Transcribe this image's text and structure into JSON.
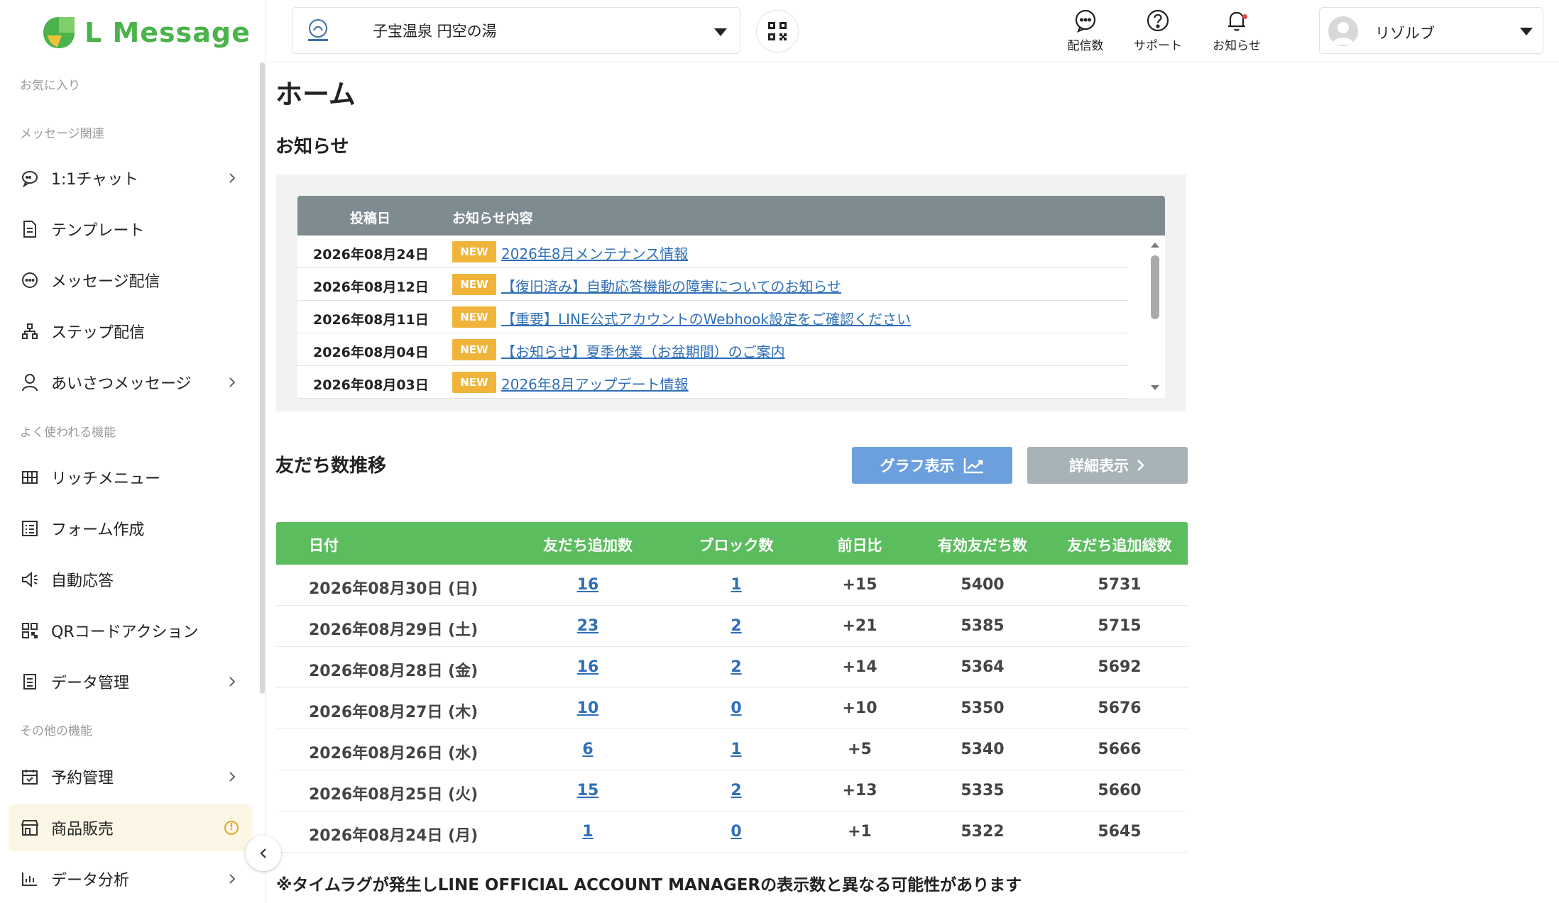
{
  "brand": {
    "logo_text": "L Message",
    "accent": "#4bb34b"
  },
  "sidebar": {
    "sections": {
      "favorites": "お気に入り",
      "message": "メッセージ関連",
      "frequent": "よく使われる機能",
      "other": "その他の機能"
    },
    "items": [
      {
        "label": "1:1チャット",
        "icon": "chat-icon",
        "chevron": true
      },
      {
        "label": "テンプレート",
        "icon": "document-icon",
        "chevron": false
      },
      {
        "label": "メッセージ配信",
        "icon": "message-icon",
        "chevron": false
      },
      {
        "label": "ステップ配信",
        "icon": "step-icon",
        "chevron": false
      },
      {
        "label": "あいさつメッセージ",
        "icon": "person-icon",
        "chevron": true
      },
      {
        "label": "リッチメニュー",
        "icon": "grid-icon",
        "chevron": false
      },
      {
        "label": "フォーム作成",
        "icon": "form-icon",
        "chevron": false
      },
      {
        "label": "自動応答",
        "icon": "speaker-icon",
        "chevron": false
      },
      {
        "label": "QRコードアクション",
        "icon": "qr-icon",
        "chevron": false
      },
      {
        "label": "データ管理",
        "icon": "data-icon",
        "chevron": true
      },
      {
        "label": "予約管理",
        "icon": "calendar-icon",
        "chevron": true
      },
      {
        "label": "商品販売",
        "icon": "shop-icon",
        "chevron": false,
        "active": true
      },
      {
        "label": "データ分析",
        "icon": "chart-icon",
        "chevron": true
      }
    ]
  },
  "topbar": {
    "account_name": "子宝温泉 円空の湯",
    "icons": [
      {
        "label": "配信数",
        "icon": "message-count-icon"
      },
      {
        "label": "サポート",
        "icon": "help-icon"
      },
      {
        "label": "お知らせ",
        "icon": "bell-icon"
      }
    ],
    "user_name": "リゾルブ"
  },
  "main": {
    "page_title": "ホーム",
    "news_title": "お知らせ",
    "news_headers": {
      "date": "投稿日",
      "content": "お知らせ内容"
    },
    "news_badge": "NEW",
    "news": [
      {
        "date": "2026年08月24日",
        "title": "2026年8月メンテナンス情報"
      },
      {
        "date": "2026年08月12日",
        "title": "【復旧済み】自動応答機能の障害についてのお知らせ"
      },
      {
        "date": "2026年08月11日",
        "title": "【重要】LINE公式アカウントのWebhook設定をご確認ください"
      },
      {
        "date": "2026年08月04日",
        "title": "【お知らせ】夏季休業（お盆期間）のご案内"
      },
      {
        "date": "2026年08月03日",
        "title": "2026年8月アップデート情報"
      }
    ],
    "friends_title": "友だち数推移",
    "graph_button": "グラフ表示",
    "detail_button": "詳細表示",
    "table_headers": [
      "日付",
      "友だち追加数",
      "ブロック数",
      "前日比",
      "有効友だち数",
      "友だち追加総数"
    ],
    "table_rows": [
      [
        "2026年08月30日 (日)",
        "16",
        "1",
        "+15",
        "5400",
        "5731"
      ],
      [
        "2026年08月29日 (土)",
        "23",
        "2",
        "+21",
        "5385",
        "5715"
      ],
      [
        "2026年08月28日 (金)",
        "16",
        "2",
        "+14",
        "5364",
        "5692"
      ],
      [
        "2026年08月27日 (木)",
        "10",
        "0",
        "+10",
        "5350",
        "5676"
      ],
      [
        "2026年08月26日 (水)",
        "6",
        "1",
        "+5",
        "5340",
        "5666"
      ],
      [
        "2026年08月25日 (火)",
        "15",
        "2",
        "+13",
        "5335",
        "5660"
      ],
      [
        "2026年08月24日 (月)",
        "1",
        "0",
        "+1",
        "5322",
        "5645"
      ]
    ],
    "footnote": "※タイムラグが発生しLINE OFFICIAL ACCOUNT MANAGERの表示数と異なる可能性があります"
  }
}
